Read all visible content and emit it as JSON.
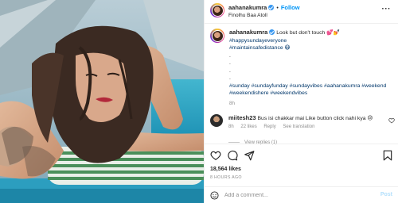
{
  "post": {
    "username": "aahanakumra",
    "follow_label": "Follow",
    "separator": "•",
    "location": "Finolhu Baa Atoll",
    "more_glyph": "···"
  },
  "caption": {
    "username": "aahanakumra",
    "text": "Look but don't touch 💕💅",
    "tags_line1": "#happysundayeveryone",
    "tags_line2": "#maintainsafedistance 😷",
    "dots": [
      ".",
      ".",
      ".",
      "."
    ],
    "tags_block": "#sunday #sundayfunday #sundayvibes #aahanakumra #weekend #weekendishere #weekendvibes",
    "age": "8h"
  },
  "comment": {
    "username": "miitesh23",
    "text": "Bus isi chakkar mai Like button click nahi kya 😢",
    "age": "8h",
    "likes": "22 likes",
    "reply": "Reply",
    "translation": "See translation",
    "view_replies": "View replies (1)"
  },
  "actions": {
    "likes_count": "18,564 likes",
    "timestamp": "8 HOURS AGO",
    "add_comment_placeholder": "Add a comment...",
    "post_label": "Post"
  },
  "icons": [
    "heart-icon",
    "comment-icon",
    "share-icon",
    "bookmark-icon",
    "emoji-icon",
    "verified-icon",
    "more-icon"
  ],
  "colors": {
    "link": "#0095f6",
    "hashtag": "#00376b",
    "muted": "#8e8e8e",
    "post_disabled": "#b2dffc"
  }
}
